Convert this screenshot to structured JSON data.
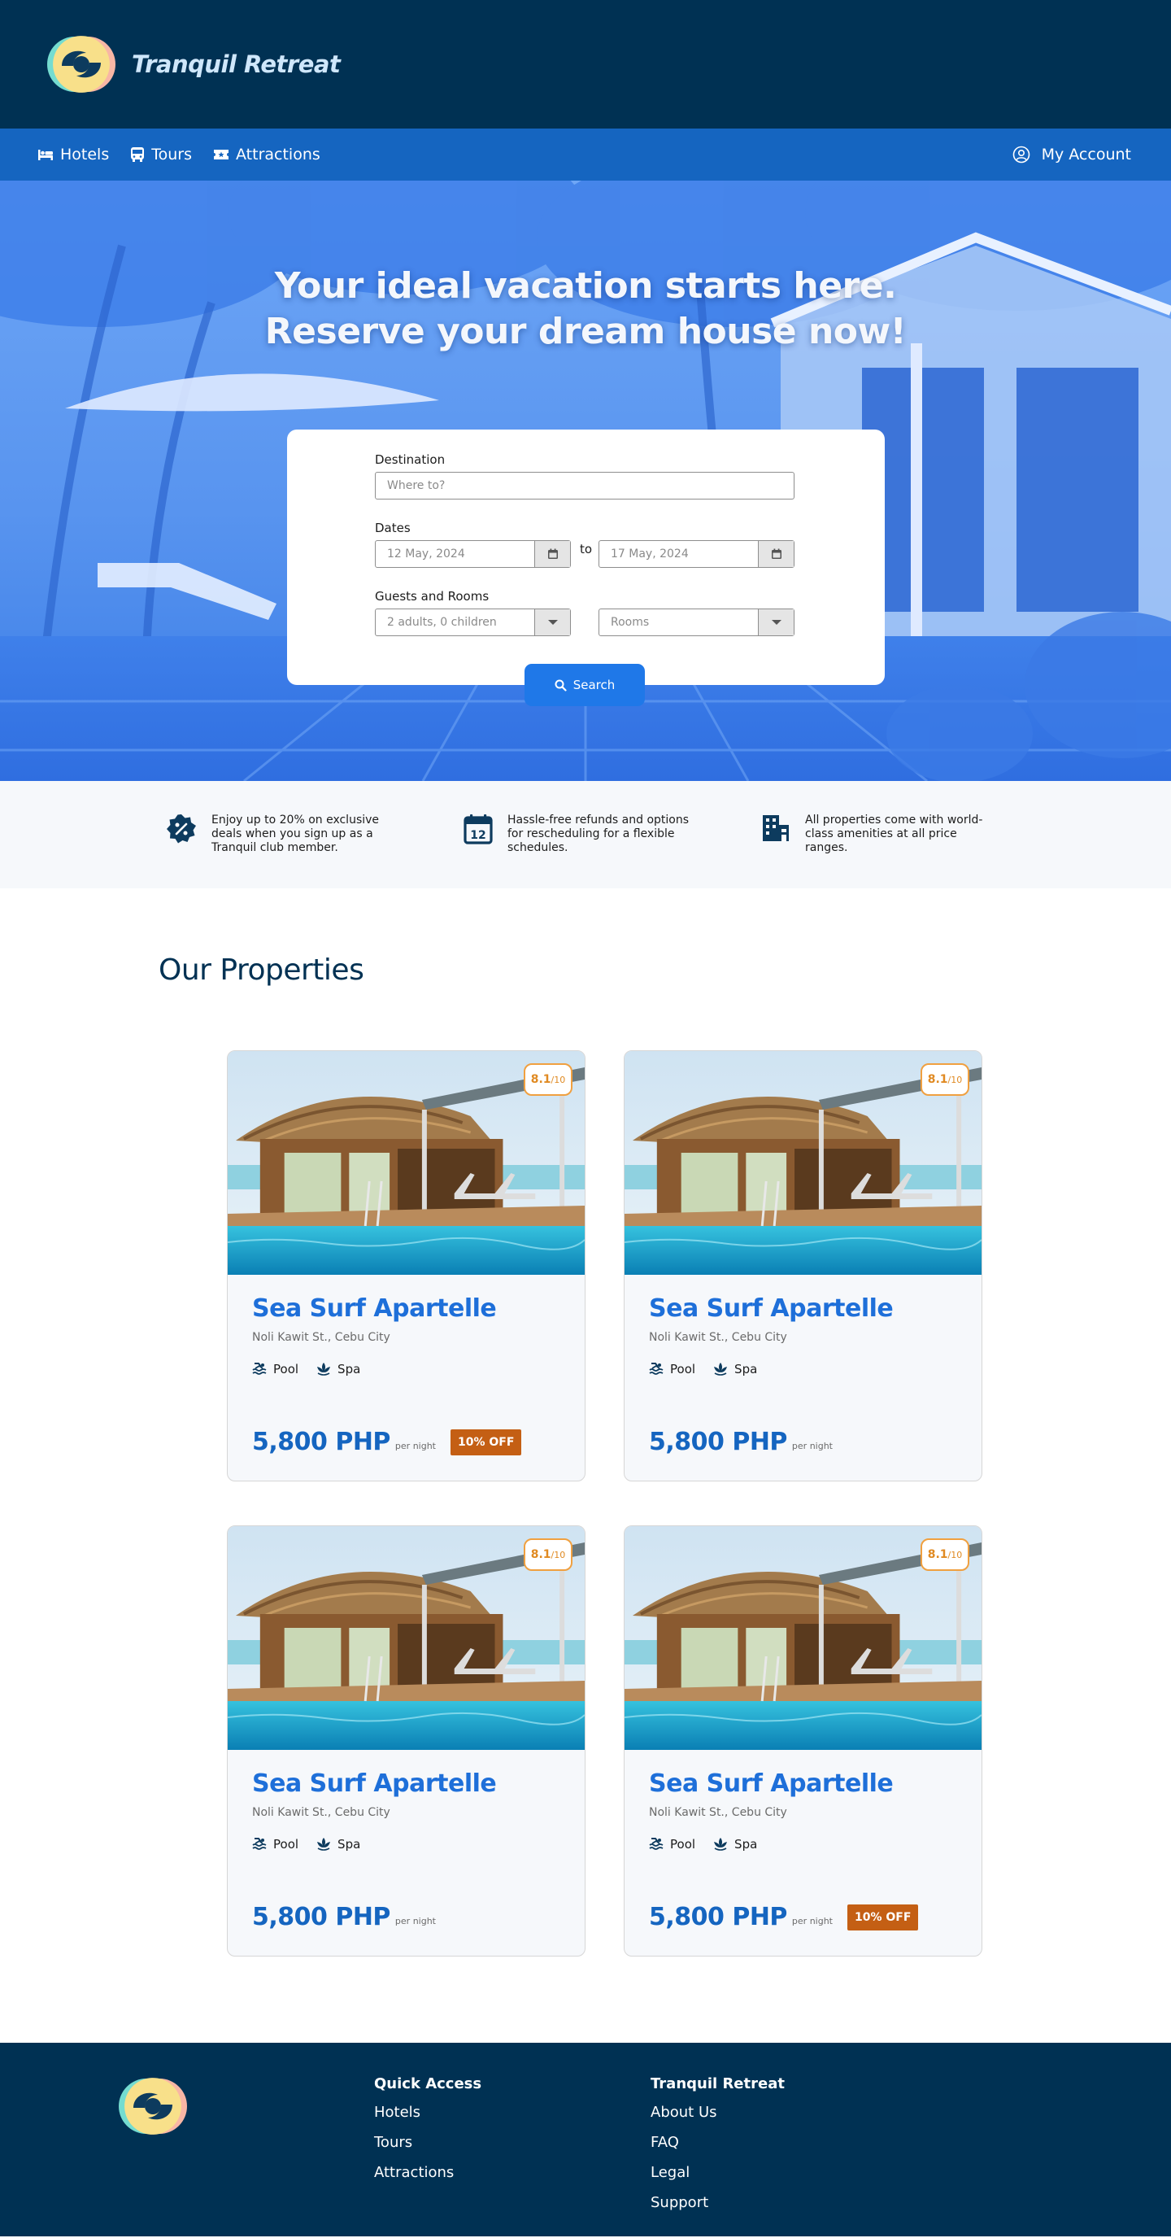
{
  "header": {
    "brand": "Tranquil Retreat"
  },
  "nav": {
    "items": [
      {
        "label": "Hotels",
        "icon": "bed-icon"
      },
      {
        "label": "Tours",
        "icon": "bus-icon"
      },
      {
        "label": "Attractions",
        "icon": "ticket-icon"
      }
    ],
    "account_label": "My Account"
  },
  "hero": {
    "title_line1": "Your ideal vacation starts here.",
    "title_line2": "Reserve your dream house now!"
  },
  "search": {
    "destination_label": "Destination",
    "destination_placeholder": "Where to?",
    "dates_label": "Dates",
    "date_from": "12 May, 2024",
    "date_to": "17 May, 2024",
    "to_label": "to",
    "guests_label": "Guests and Rooms",
    "guests_value": "2 adults, 0 children",
    "rooms_placeholder": "Rooms",
    "button_label": "Search"
  },
  "features": [
    {
      "icon": "discount-badge-icon",
      "text": "Enjoy up to 20% on exclusive deals when you sign up as a Tranquil club member."
    },
    {
      "icon": "calendar-icon",
      "text": "Hassle-free refunds and options for rescheduling for a flexible schedules."
    },
    {
      "icon": "building-icon",
      "text": "All properties come with world-class amenities at all price ranges."
    }
  ],
  "properties": {
    "title": "Our Properties",
    "cards": [
      {
        "name": "Sea Surf Apartelle",
        "address": "Noli Kawit St., Cebu City",
        "rating": "8.1",
        "rating_max": "/10",
        "amenities": [
          "Pool",
          "Spa"
        ],
        "price": "5,800 PHP",
        "per_night": "per night",
        "discount": "10% OFF"
      },
      {
        "name": "Sea Surf Apartelle",
        "address": "Noli Kawit St., Cebu City",
        "rating": "8.1",
        "rating_max": "/10",
        "amenities": [
          "Pool",
          "Spa"
        ],
        "price": "5,800 PHP",
        "per_night": "per night",
        "discount": ""
      },
      {
        "name": "Sea Surf Apartelle",
        "address": "Noli Kawit St., Cebu City",
        "rating": "8.1",
        "rating_max": "/10",
        "amenities": [
          "Pool",
          "Spa"
        ],
        "price": "5,800 PHP",
        "per_night": "per night",
        "discount": ""
      },
      {
        "name": "Sea Surf Apartelle",
        "address": "Noli Kawit St., Cebu City",
        "rating": "8.1",
        "rating_max": "/10",
        "amenities": [
          "Pool",
          "Spa"
        ],
        "price": "5,800 PHP",
        "per_night": "per night",
        "discount": "10% OFF"
      }
    ]
  },
  "footer": {
    "col1_title": "Quick Access",
    "col1_links": [
      "Hotels",
      "Tours",
      "Attractions"
    ],
    "col2_title": "Tranquil Retreat",
    "col2_links": [
      "About Us",
      "FAQ",
      "Legal",
      "Support"
    ]
  },
  "colors": {
    "navy": "#003153",
    "nav_blue": "#1565c0",
    "accent": "#1f78e8",
    "discount": "#c45f14",
    "rating": "#e08a22"
  }
}
